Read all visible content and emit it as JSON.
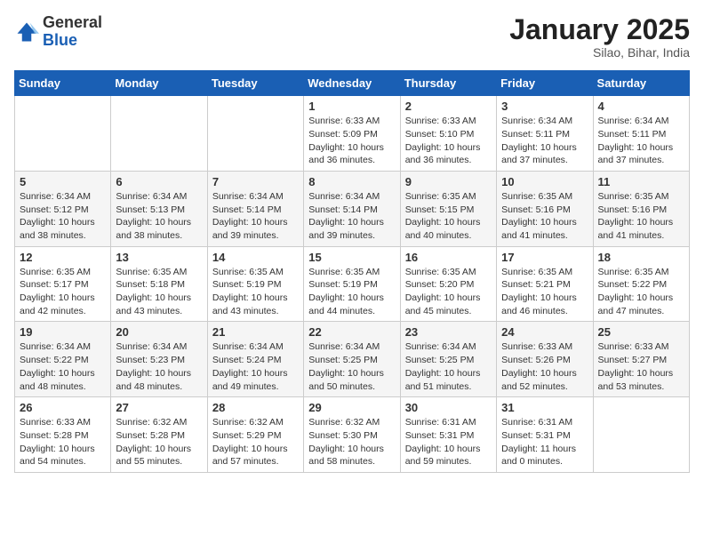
{
  "header": {
    "logo_general": "General",
    "logo_blue": "Blue",
    "title": "January 2025",
    "subtitle": "Silao, Bihar, India"
  },
  "weekdays": [
    "Sunday",
    "Monday",
    "Tuesday",
    "Wednesday",
    "Thursday",
    "Friday",
    "Saturday"
  ],
  "weeks": [
    [
      {
        "day": "",
        "info": ""
      },
      {
        "day": "",
        "info": ""
      },
      {
        "day": "",
        "info": ""
      },
      {
        "day": "1",
        "info": "Sunrise: 6:33 AM\nSunset: 5:09 PM\nDaylight: 10 hours\nand 36 minutes."
      },
      {
        "day": "2",
        "info": "Sunrise: 6:33 AM\nSunset: 5:10 PM\nDaylight: 10 hours\nand 36 minutes."
      },
      {
        "day": "3",
        "info": "Sunrise: 6:34 AM\nSunset: 5:11 PM\nDaylight: 10 hours\nand 37 minutes."
      },
      {
        "day": "4",
        "info": "Sunrise: 6:34 AM\nSunset: 5:11 PM\nDaylight: 10 hours\nand 37 minutes."
      }
    ],
    [
      {
        "day": "5",
        "info": "Sunrise: 6:34 AM\nSunset: 5:12 PM\nDaylight: 10 hours\nand 38 minutes."
      },
      {
        "day": "6",
        "info": "Sunrise: 6:34 AM\nSunset: 5:13 PM\nDaylight: 10 hours\nand 38 minutes."
      },
      {
        "day": "7",
        "info": "Sunrise: 6:34 AM\nSunset: 5:14 PM\nDaylight: 10 hours\nand 39 minutes."
      },
      {
        "day": "8",
        "info": "Sunrise: 6:34 AM\nSunset: 5:14 PM\nDaylight: 10 hours\nand 39 minutes."
      },
      {
        "day": "9",
        "info": "Sunrise: 6:35 AM\nSunset: 5:15 PM\nDaylight: 10 hours\nand 40 minutes."
      },
      {
        "day": "10",
        "info": "Sunrise: 6:35 AM\nSunset: 5:16 PM\nDaylight: 10 hours\nand 41 minutes."
      },
      {
        "day": "11",
        "info": "Sunrise: 6:35 AM\nSunset: 5:16 PM\nDaylight: 10 hours\nand 41 minutes."
      }
    ],
    [
      {
        "day": "12",
        "info": "Sunrise: 6:35 AM\nSunset: 5:17 PM\nDaylight: 10 hours\nand 42 minutes."
      },
      {
        "day": "13",
        "info": "Sunrise: 6:35 AM\nSunset: 5:18 PM\nDaylight: 10 hours\nand 43 minutes."
      },
      {
        "day": "14",
        "info": "Sunrise: 6:35 AM\nSunset: 5:19 PM\nDaylight: 10 hours\nand 43 minutes."
      },
      {
        "day": "15",
        "info": "Sunrise: 6:35 AM\nSunset: 5:19 PM\nDaylight: 10 hours\nand 44 minutes."
      },
      {
        "day": "16",
        "info": "Sunrise: 6:35 AM\nSunset: 5:20 PM\nDaylight: 10 hours\nand 45 minutes."
      },
      {
        "day": "17",
        "info": "Sunrise: 6:35 AM\nSunset: 5:21 PM\nDaylight: 10 hours\nand 46 minutes."
      },
      {
        "day": "18",
        "info": "Sunrise: 6:35 AM\nSunset: 5:22 PM\nDaylight: 10 hours\nand 47 minutes."
      }
    ],
    [
      {
        "day": "19",
        "info": "Sunrise: 6:34 AM\nSunset: 5:22 PM\nDaylight: 10 hours\nand 48 minutes."
      },
      {
        "day": "20",
        "info": "Sunrise: 6:34 AM\nSunset: 5:23 PM\nDaylight: 10 hours\nand 48 minutes."
      },
      {
        "day": "21",
        "info": "Sunrise: 6:34 AM\nSunset: 5:24 PM\nDaylight: 10 hours\nand 49 minutes."
      },
      {
        "day": "22",
        "info": "Sunrise: 6:34 AM\nSunset: 5:25 PM\nDaylight: 10 hours\nand 50 minutes."
      },
      {
        "day": "23",
        "info": "Sunrise: 6:34 AM\nSunset: 5:25 PM\nDaylight: 10 hours\nand 51 minutes."
      },
      {
        "day": "24",
        "info": "Sunrise: 6:33 AM\nSunset: 5:26 PM\nDaylight: 10 hours\nand 52 minutes."
      },
      {
        "day": "25",
        "info": "Sunrise: 6:33 AM\nSunset: 5:27 PM\nDaylight: 10 hours\nand 53 minutes."
      }
    ],
    [
      {
        "day": "26",
        "info": "Sunrise: 6:33 AM\nSunset: 5:28 PM\nDaylight: 10 hours\nand 54 minutes."
      },
      {
        "day": "27",
        "info": "Sunrise: 6:32 AM\nSunset: 5:28 PM\nDaylight: 10 hours\nand 55 minutes."
      },
      {
        "day": "28",
        "info": "Sunrise: 6:32 AM\nSunset: 5:29 PM\nDaylight: 10 hours\nand 57 minutes."
      },
      {
        "day": "29",
        "info": "Sunrise: 6:32 AM\nSunset: 5:30 PM\nDaylight: 10 hours\nand 58 minutes."
      },
      {
        "day": "30",
        "info": "Sunrise: 6:31 AM\nSunset: 5:31 PM\nDaylight: 10 hours\nand 59 minutes."
      },
      {
        "day": "31",
        "info": "Sunrise: 6:31 AM\nSunset: 5:31 PM\nDaylight: 11 hours\nand 0 minutes."
      },
      {
        "day": "",
        "info": ""
      }
    ]
  ]
}
